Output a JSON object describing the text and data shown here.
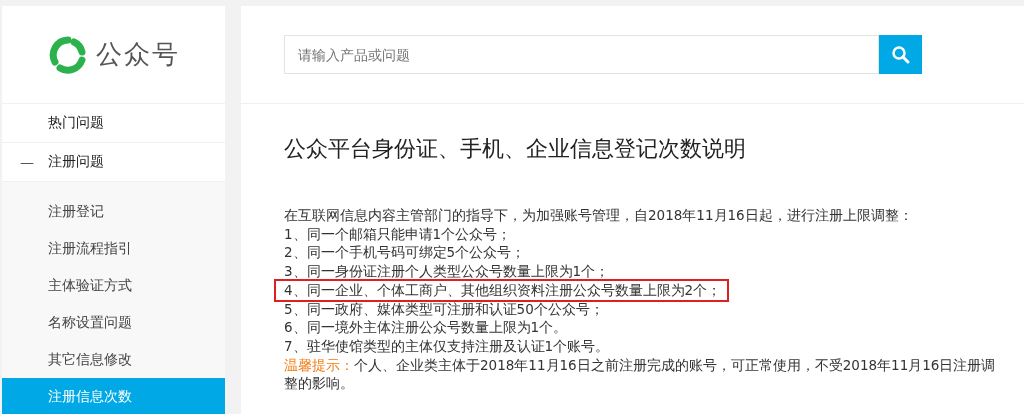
{
  "logo": {
    "text": "公众号"
  },
  "sidebar": {
    "items": [
      {
        "label": "热门问题",
        "selected": false
      },
      {
        "label": "注册问题",
        "selected": false,
        "expanded": true,
        "toggle": "—",
        "children": [
          {
            "label": "注册登记",
            "selected": false
          },
          {
            "label": "注册流程指引",
            "selected": false
          },
          {
            "label": "主体验证方式",
            "selected": false
          },
          {
            "label": "名称设置问题",
            "selected": false
          },
          {
            "label": "其它信息修改",
            "selected": false
          },
          {
            "label": "注册信息次数",
            "selected": true
          }
        ]
      }
    ]
  },
  "search": {
    "placeholder": "请输入产品或问题"
  },
  "article": {
    "title": "公众平台身份证、手机、企业信息登记次数说明",
    "intro": "在互联网信息内容主管部门的指导下，为加强账号管理，自2018年11月16日起，进行注册上限调整：",
    "lines": [
      {
        "text": "1、同一个邮箱只能申请1个公众号；",
        "highlighted": false
      },
      {
        "text": "2、同一个手机号码可绑定5个公众号；",
        "highlighted": false
      },
      {
        "text": "3、同一身份证注册个人类型公众号数量上限为1个；",
        "highlighted": false
      },
      {
        "text": "4、同一企业、个体工商户、其他组织资料注册公众号数量上限为2个；",
        "highlighted": true
      },
      {
        "text": "5、同一政府、媒体类型可注册和认证50个公众号；",
        "highlighted": false
      },
      {
        "text": "6、同一境外主体注册公众号数量上限为1个。",
        "highlighted": false
      },
      {
        "text": "7、驻华使馆类型的主体仅支持注册及认证1个账号。",
        "highlighted": false
      }
    ],
    "tip": {
      "label": "温馨提示：",
      "text": "个人、企业类主体于2018年11月16日之前注册完成的账号，可正常使用，不受2018年11月16日注册调整的影响。"
    }
  }
}
